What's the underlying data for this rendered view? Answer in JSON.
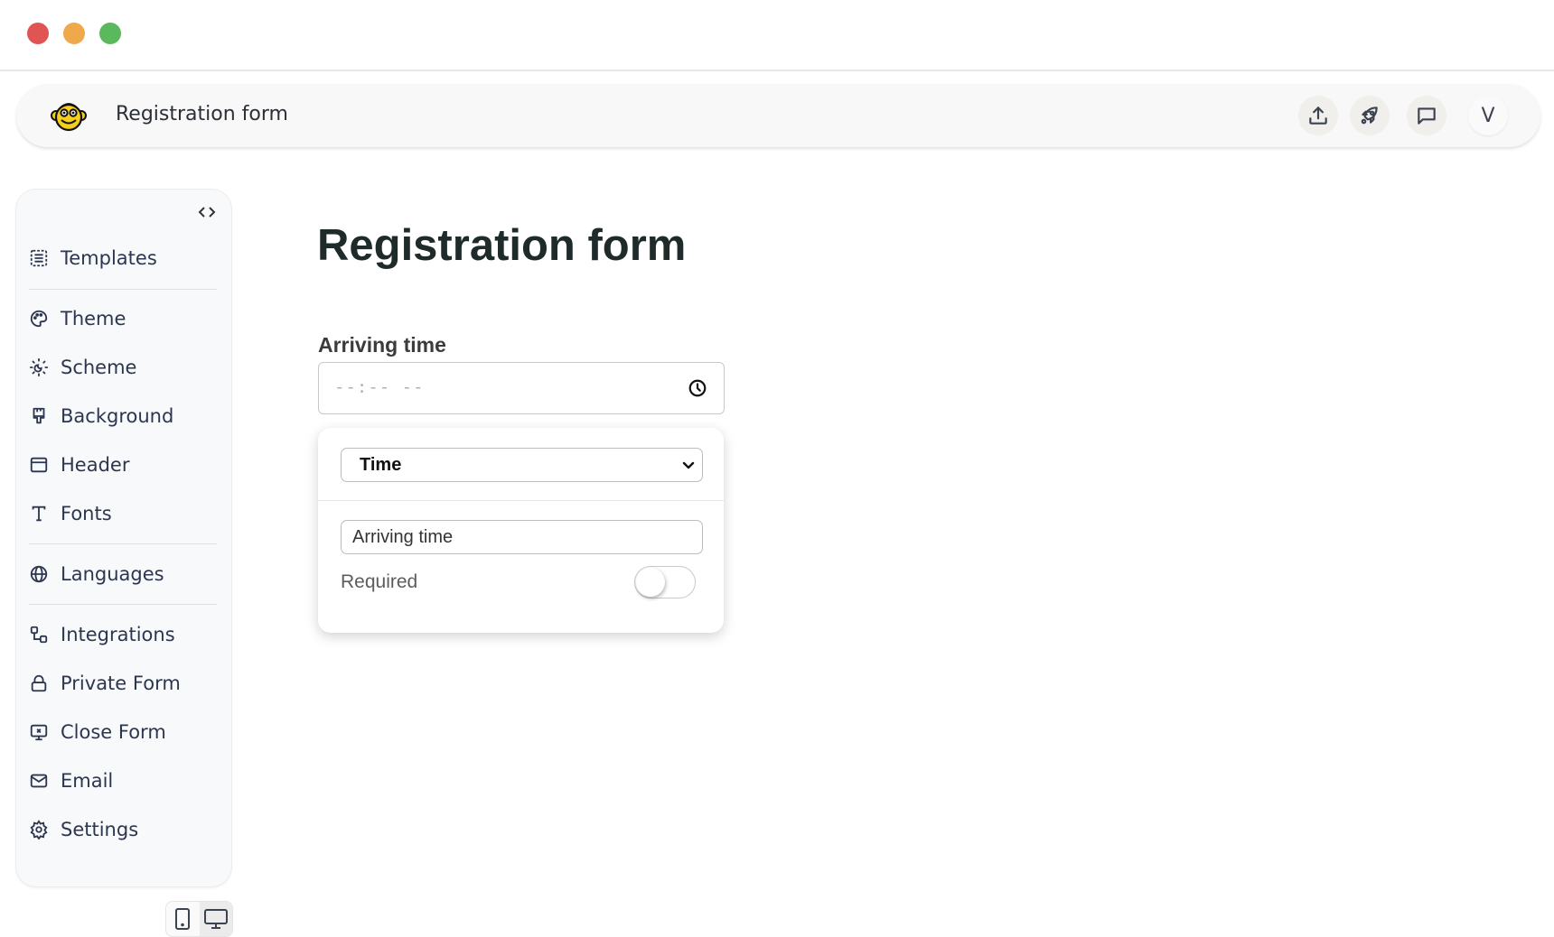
{
  "window": {
    "controls": [
      {
        "name": "close",
        "color": "#e05553"
      },
      {
        "name": "minimize",
        "color": "#f0a94a"
      },
      {
        "name": "maximize",
        "color": "#5cb85c"
      }
    ]
  },
  "header": {
    "logo": "monkey-logo",
    "title": "Registration form",
    "actions": [
      {
        "name": "upload-icon",
        "label": "Publish"
      },
      {
        "name": "rocket-icon",
        "label": "Launch"
      },
      {
        "name": "comment-icon",
        "label": "Feedback"
      }
    ],
    "avatar_initial": "V"
  },
  "sidebar": {
    "collapse_icon": "code-brackets-icon",
    "items": [
      {
        "label": "Templates",
        "icon": "templates-icon"
      },
      {
        "label": "Theme",
        "icon": "palette-icon"
      },
      {
        "label": "Scheme",
        "icon": "sun-moon-icon"
      },
      {
        "label": "Background",
        "icon": "paintbrush-icon"
      },
      {
        "label": "Header",
        "icon": "header-layout-icon"
      },
      {
        "label": "Fonts",
        "icon": "type-icon"
      },
      {
        "label": "Languages",
        "icon": "globe-icon"
      },
      {
        "label": "Integrations",
        "icon": "integrations-icon"
      },
      {
        "label": "Private Form",
        "icon": "lock-icon"
      },
      {
        "label": "Close Form",
        "icon": "monitor-x-icon"
      },
      {
        "label": "Email",
        "icon": "mail-icon"
      },
      {
        "label": "Settings",
        "icon": "gear-icon"
      }
    ],
    "device_toggle": {
      "options": [
        "mobile",
        "desktop"
      ],
      "active": "desktop"
    }
  },
  "form": {
    "title": "Registration form",
    "field": {
      "label": "Arriving time",
      "placeholder": "--:-- --"
    },
    "editor": {
      "type_selected": "Time",
      "label_value": "Arriving time",
      "required_label": "Required",
      "required": false
    }
  },
  "colors": {
    "text_primary": "#2c3650",
    "title": "#1f2a2a"
  }
}
